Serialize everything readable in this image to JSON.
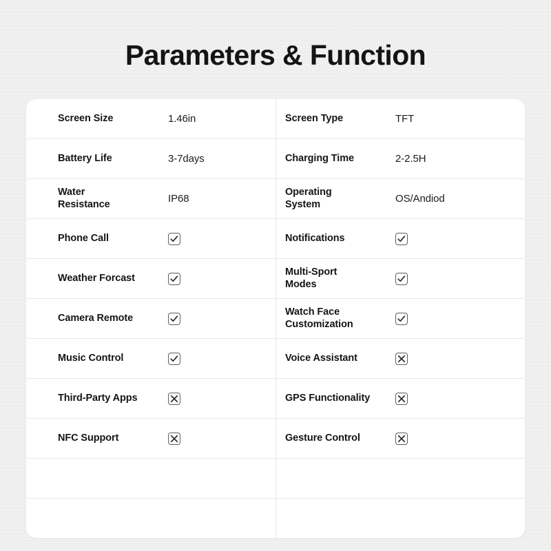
{
  "page": {
    "title": "Parameters & Function",
    "background_color": "#f1f1f1",
    "card_background": "#ffffff",
    "text_color": "#151515",
    "divider_color": "#e9e9e9",
    "mark_color": "#5d5d5d"
  },
  "table": {
    "rows": [
      {
        "left": {
          "label": "Screen Size",
          "value": "1.46in",
          "type": "text"
        },
        "right": {
          "label": "Screen Type",
          "value": "TFT",
          "type": "text"
        }
      },
      {
        "left": {
          "label": "Battery Life",
          "value": "3-7days",
          "type": "text"
        },
        "right": {
          "label": "Charging Time",
          "value": "2-2.5H",
          "type": "text"
        }
      },
      {
        "left": {
          "label": "Water\nResistance",
          "value": "IP68",
          "type": "text"
        },
        "right": {
          "label": "Operating\nSystem",
          "value": "OS/Andiod",
          "type": "text"
        }
      },
      {
        "left": {
          "label": "Phone Call",
          "value": "checked",
          "type": "mark",
          "icon": "checkbox-checked-icon"
        },
        "right": {
          "label": "Notifications",
          "value": "checked",
          "type": "mark",
          "icon": "checkbox-checked-icon"
        }
      },
      {
        "left": {
          "label": "Weather Forcast",
          "value": "checked",
          "type": "mark",
          "icon": "checkbox-checked-icon"
        },
        "right": {
          "label": "Multi-Sport\nModes",
          "value": "checked",
          "type": "mark",
          "icon": "checkbox-checked-icon"
        }
      },
      {
        "left": {
          "label": "Camera Remote",
          "value": "checked",
          "type": "mark",
          "icon": "checkbox-checked-icon"
        },
        "right": {
          "label": "Watch Face\nCustomization",
          "value": "checked",
          "type": "mark",
          "icon": "checkbox-checked-icon"
        }
      },
      {
        "left": {
          "label": "Music Control",
          "value": "checked",
          "type": "mark",
          "icon": "checkbox-checked-icon"
        },
        "right": {
          "label": "Voice Assistant",
          "value": "crossed",
          "type": "mark",
          "icon": "checkbox-crossed-icon"
        }
      },
      {
        "left": {
          "label": "Third-Party Apps",
          "value": "crossed",
          "type": "mark",
          "icon": "checkbox-crossed-icon"
        },
        "right": {
          "label": "GPS Functionality",
          "value": "crossed",
          "type": "mark",
          "icon": "checkbox-crossed-icon"
        }
      },
      {
        "left": {
          "label": "NFC Support",
          "value": "crossed",
          "type": "mark",
          "icon": "checkbox-crossed-icon"
        },
        "right": {
          "label": "Gesture Control",
          "value": "crossed",
          "type": "mark",
          "icon": "checkbox-crossed-icon"
        }
      },
      {
        "left": {
          "label": "",
          "value": "",
          "type": "empty"
        },
        "right": {
          "label": "",
          "value": "",
          "type": "empty"
        }
      },
      {
        "left": {
          "label": "",
          "value": "",
          "type": "empty"
        },
        "right": {
          "label": "",
          "value": "",
          "type": "empty"
        }
      }
    ]
  }
}
